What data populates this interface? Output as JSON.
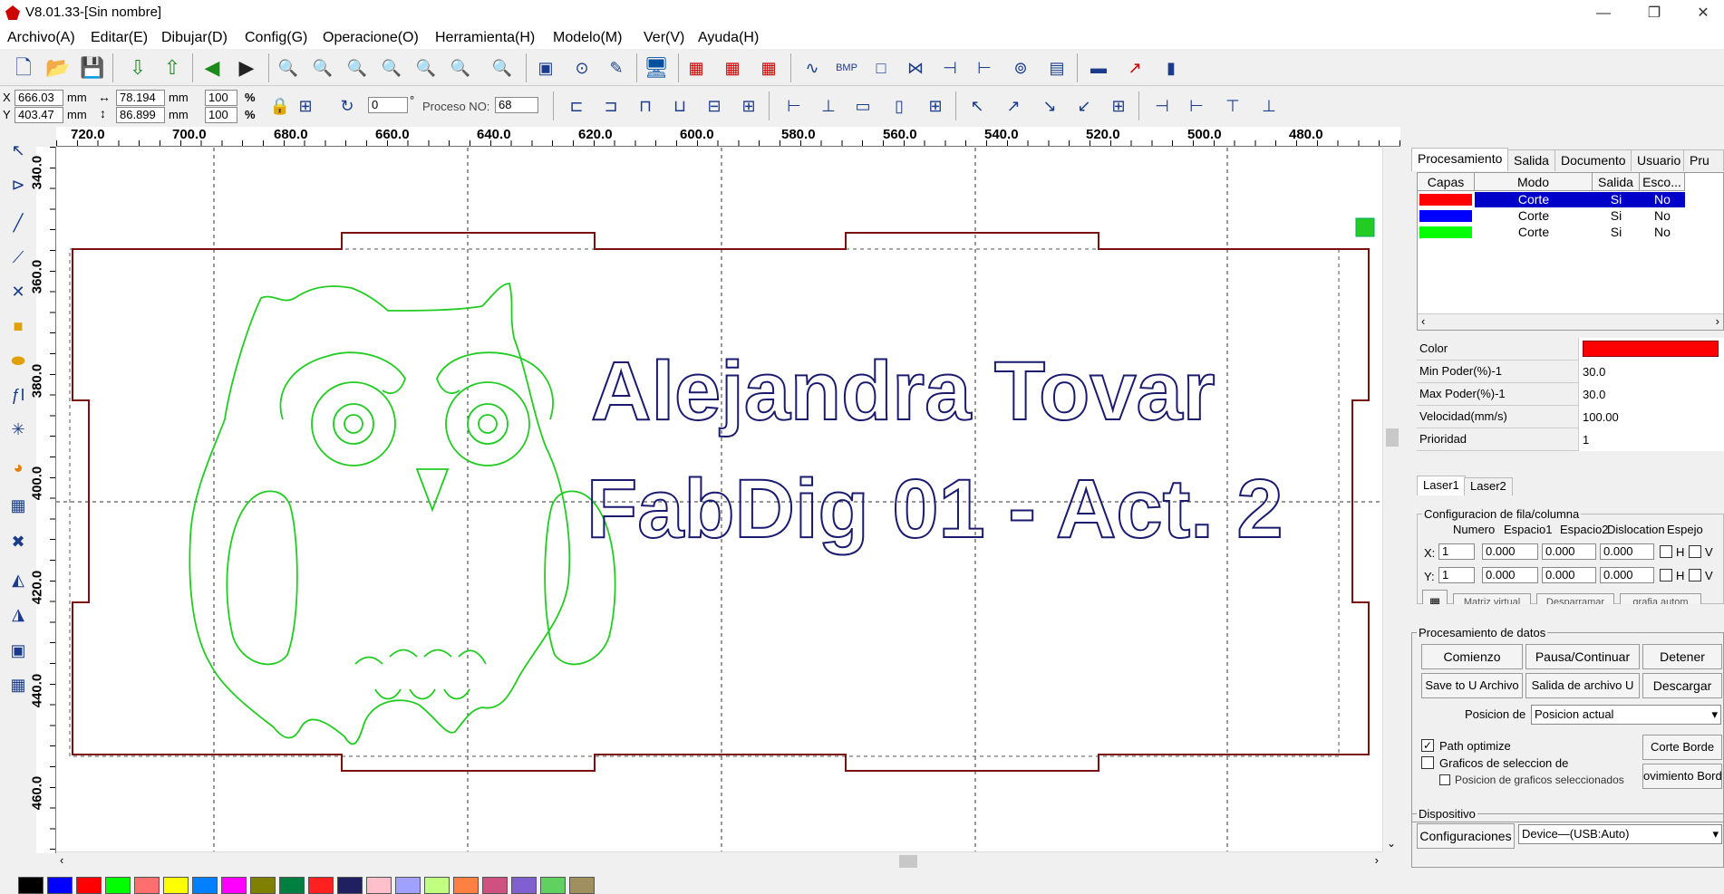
{
  "window": {
    "title": "V8.01.33-[Sin nombre]",
    "min": "—",
    "max": "❐",
    "close": "✕"
  },
  "menu": [
    "Archivo(A)",
    "Editar(E)",
    "Dibujar(D)",
    "Config(G)",
    "Operacione(O)",
    "Herramienta(H)",
    "Modelo(M)",
    "Ver(V)",
    "Ayuda(H)"
  ],
  "coords": {
    "x_label": "X",
    "y_label": "Y",
    "x": "666.03",
    "y": "403.47",
    "unit": "mm",
    "w": "78.194",
    "h": "86.899",
    "sx": "100",
    "sy": "100",
    "pct": "%",
    "angle": "0",
    "deg": "°",
    "proceso_label": "Proceso NO:",
    "proceso": "68"
  },
  "ruler_top": [
    "720.0",
    "700.0",
    "680.0",
    "660.0",
    "640.0",
    "620.0",
    "600.0",
    "580.0",
    "560.0",
    "540.0",
    "520.0",
    "500.0",
    "480.0"
  ],
  "ruler_left": [
    "340.0",
    "360.0",
    "380.0",
    "400.0",
    "420.0",
    "440.0",
    "460.0"
  ],
  "canvas": {
    "text_line1": "Alejandra Tovar",
    "text_line2": "FabDig 01 - Act. 2"
  },
  "colors": {
    "layer1": "#ff0000",
    "layer2": "#0000ff",
    "layer3": "#00ff00",
    "owl": "#22cc22",
    "text": "#1a1a6e",
    "border": "#7a1010",
    "selected": "#0000c8"
  },
  "panel": {
    "tabs": [
      "Procesamiento",
      "Salida",
      "Documento",
      "Usuario",
      "Pru"
    ],
    "headers": [
      "Capas",
      "Modo",
      "Salida",
      "Esco..."
    ],
    "layers": [
      {
        "mode": "Corte",
        "out": "Si",
        "esc": "No"
      },
      {
        "mode": "Corte",
        "out": "Si",
        "esc": "No"
      },
      {
        "mode": "Corte",
        "out": "Si",
        "esc": "No"
      }
    ],
    "props": [
      {
        "k": "Color",
        "v": ""
      },
      {
        "k": "Min Poder(%)-1",
        "v": "30.0"
      },
      {
        "k": "Max Poder(%)-1",
        "v": "30.0"
      },
      {
        "k": "Velocidad(mm/s)",
        "v": "100.00"
      },
      {
        "k": "Prioridad",
        "v": "1"
      }
    ],
    "laser_tabs": [
      "Laser1",
      "Laser2"
    ],
    "array_title": "Configuracion de fila/columna",
    "array_headers": [
      "Numero",
      "Espacio1",
      "Espacio2",
      "Dislocation",
      "Espejo"
    ],
    "array_x": [
      "X:",
      "1",
      "0.000",
      "0.000",
      "0.000",
      "H",
      "V"
    ],
    "array_y": [
      "Y:",
      "1",
      "0.000",
      "0.000",
      "0.000",
      "H",
      "V"
    ],
    "array_btns": [
      "Matriz virtual",
      "Desparramar",
      "grafia autom"
    ],
    "proc_title": "Procesamiento de datos",
    "btn_start": "Comienzo",
    "btn_pause": "Pausa/Continuar",
    "btn_stop": "Detener",
    "btn_saveu": "Save to U Archivo",
    "btn_outu": "Salida de archivo U",
    "btn_download": "Descargar",
    "pos_label": "Posicion de",
    "pos_value": "Posicion actual",
    "path_opt": "Path optimize",
    "sel_graphics": "Graficos de seleccion de",
    "sel_pos": "Posicion de graficos seleccionados",
    "btn_corte": "Corte Borde",
    "btn_mov": "ovimiento Bord",
    "device_title": "Dispositivo",
    "btn_config": "Configuraciones",
    "device_value": "Device—(USB:Auto)"
  },
  "palette": [
    "#000000",
    "#0000ff",
    "#ff0000",
    "#00ff00",
    "#ff6f6f",
    "#ffff00",
    "#0080ff",
    "#ff00ff",
    "#808000",
    "#008040",
    "#ff2020",
    "#202060",
    "#ffc0cb",
    "#a0a0ff",
    "#c0ff80",
    "#ff8040",
    "#d05080",
    "#8060d0",
    "#60d060",
    "#a09060"
  ]
}
